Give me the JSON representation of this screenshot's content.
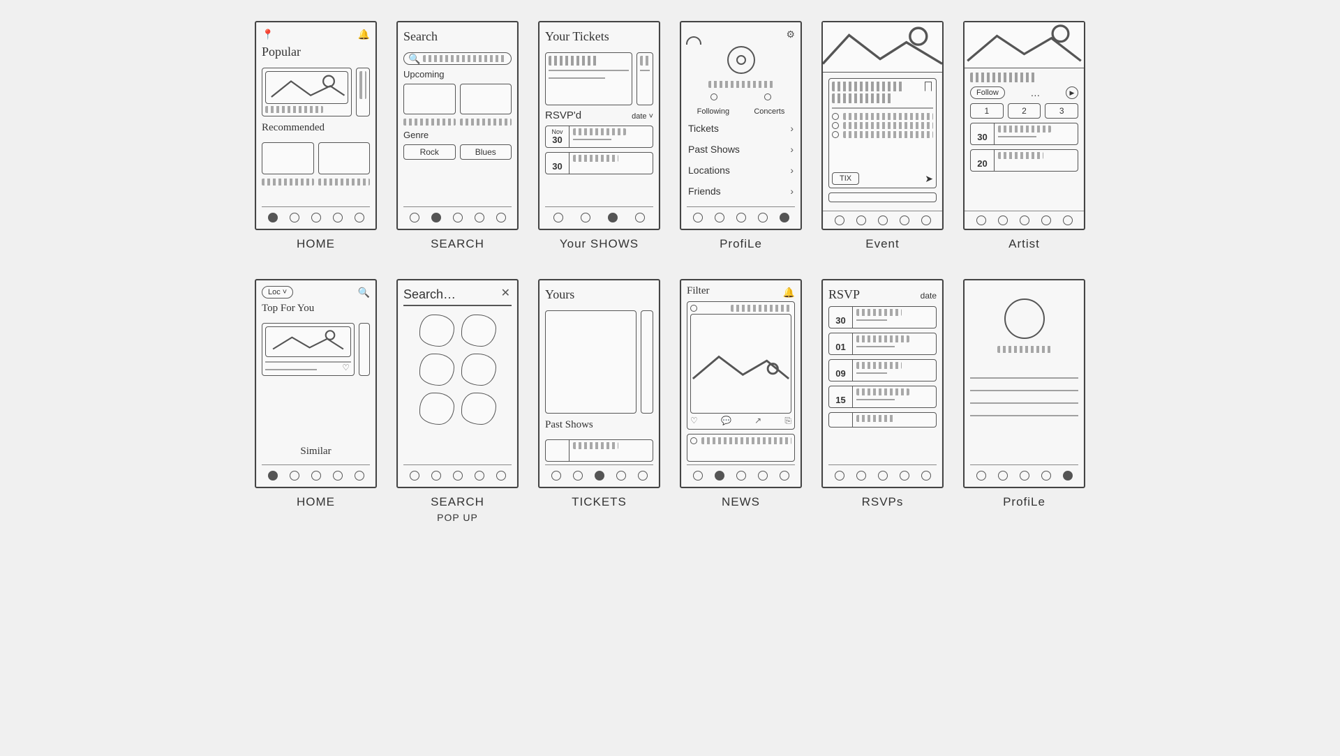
{
  "row1": {
    "home": {
      "label": "HOME",
      "section_popular": "Popular",
      "section_recommended": "Recommended",
      "nav_active": 0
    },
    "search": {
      "label": "SEARCH",
      "title": "Search",
      "section_upcoming": "Upcoming",
      "section_genre": "Genre",
      "genre1": "Rock",
      "genre2": "Blues",
      "nav_active": 1
    },
    "your_shows": {
      "label": "Your SHOWS",
      "title": "Your Tickets",
      "rsvp_label": "RSVP'd",
      "date_label": "date ˅",
      "row1_month": "Nov",
      "row1_day": "30",
      "row2_day": "30",
      "nav_active": 2
    },
    "profile": {
      "label": "ProfiLe",
      "tab_following": "Following",
      "tab_concerts": "Concerts",
      "menu_tickets": "Tickets",
      "menu_past": "Past Shows",
      "menu_locations": "Locations",
      "menu_friends": "Friends",
      "nav_active": 4
    },
    "event": {
      "label": "Event",
      "tix": "TIX"
    },
    "artist": {
      "label": "Artist",
      "follow": "Follow",
      "chip1": "1",
      "chip2": "2",
      "chip3": "3",
      "row1_day": "30",
      "row2_day": "20"
    }
  },
  "row2": {
    "home2": {
      "label": "HOME",
      "pill": "Loc ˅",
      "section_top": "Top For You",
      "section_similar": "Similar",
      "nav_active": 0
    },
    "search_popup": {
      "label": "SEARCH",
      "sublabel": "POP UP",
      "placeholder": "Search…"
    },
    "tickets": {
      "label": "TICKETS",
      "section_yours": "Yours",
      "section_past": "Past Shows",
      "nav_active": 2
    },
    "news": {
      "label": "NEWS",
      "title": "Filter",
      "nav_active": 1
    },
    "rsvps": {
      "label": "RSVPs",
      "title": "RSVP",
      "date_label": "date",
      "d1": "30",
      "d2": "01",
      "d3": "09",
      "d4": "15"
    },
    "profile2": {
      "label": "ProfiLe",
      "nav_active": 4
    }
  }
}
